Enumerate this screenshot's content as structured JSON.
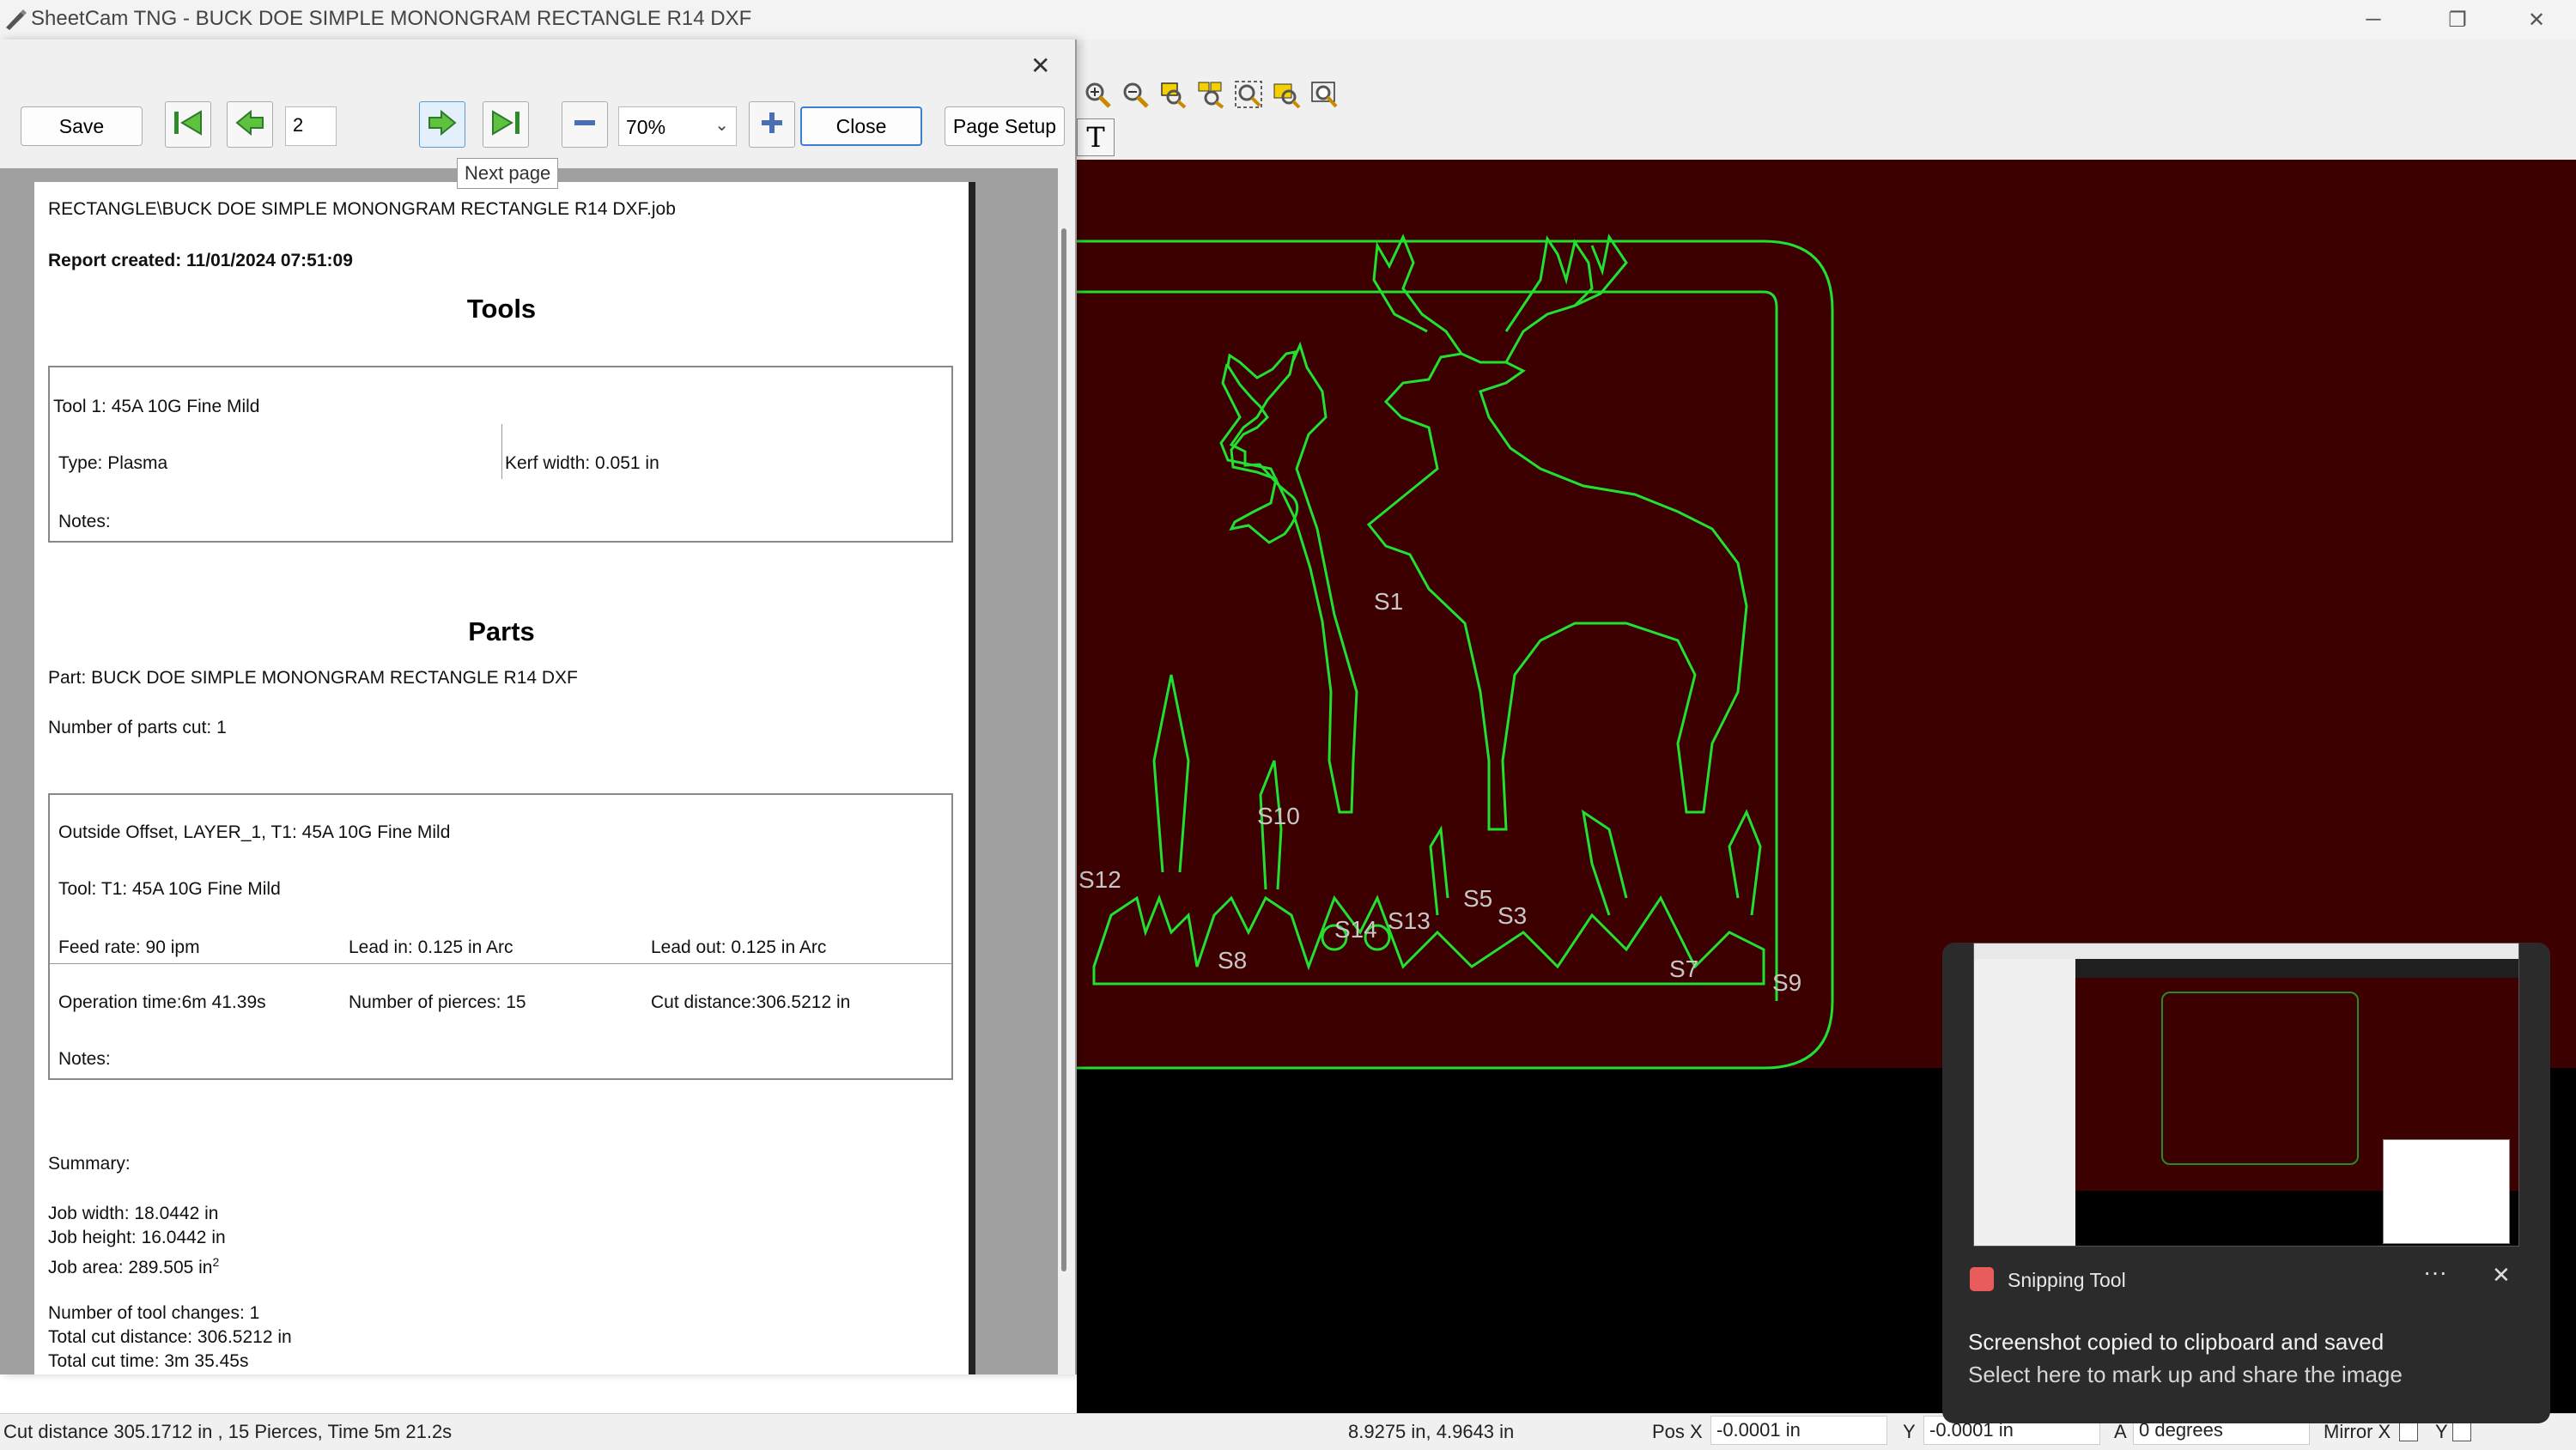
{
  "window": {
    "title": "SheetCam TNG - BUCK DOE SIMPLE MONONGRAM RECTANGLE R14 DXF",
    "minimize": "─",
    "restore": "❐",
    "close": "✕"
  },
  "preview": {
    "close": "✕",
    "save_label": "Save",
    "page_number": "2",
    "zoom": "70%",
    "close_label": "Close",
    "page_setup_label": "Page Setup",
    "tooltip": "Next page"
  },
  "report": {
    "job_path": "RECTANGLE\\BUCK DOE SIMPLE MONONGRAM RECTANGLE R14 DXF.job",
    "created": "Report created: 11/01/2024 07:51:09",
    "tools_heading": "Tools",
    "tool": {
      "name": "Tool 1: 45A 10G Fine Mild",
      "type": "Type: Plasma",
      "kerf": "Kerf width: 0.051 in",
      "notes": "Notes:"
    },
    "parts_heading": "Parts",
    "part_name": "Part: BUCK DOE SIMPLE MONONGRAM RECTANGLE R14 DXF",
    "parts_cut": "Number of parts cut: 1",
    "operation": {
      "title": "Outside Offset, LAYER_1, T1: 45A 10G Fine Mild",
      "tool": "Tool: T1: 45A 10G Fine Mild",
      "feed": "Feed rate: 90 ipm",
      "lead_in": "Lead in: 0.125 in Arc",
      "lead_out": "Lead out: 0.125 in Arc",
      "op_time": "Operation time:6m 41.39s",
      "pierces": "Number of pierces: 15",
      "cut_distance": "Cut distance:306.5212 in",
      "notes": "Notes:"
    },
    "summary": {
      "heading": "Summary:",
      "job_width": "Job width: 18.0442 in",
      "job_height": "Job height: 16.0442 in",
      "job_area": "Job area: 289.505 in",
      "job_area_sup": "2",
      "tool_changes": "Number of tool changes: 1",
      "total_cut_distance": "Total cut distance: 306.5212 in",
      "total_cut_time": "Total cut time: 3m 35.45s"
    }
  },
  "canvas": {
    "labels": [
      "S1",
      "S10",
      "S12",
      "S14",
      "S13",
      "S5",
      "S3",
      "S8",
      "S7",
      "S9"
    ],
    "background_color": "#3d0000",
    "path_color": "#22e030"
  },
  "statusbar": {
    "cut_info": "Cut distance 305.1712 in , 15 Pierces, Time 5m 21.2s",
    "cursor": "8.9275 in, 4.9643 in",
    "pos_x_label": "Pos X",
    "pos_x": "-0.0001 in",
    "y_label": "Y",
    "pos_y": "-0.0001 in",
    "a_label": "A",
    "angle": "0 degrees",
    "mirror_x": "Mirror X",
    "mirror_y": "Y"
  },
  "toast": {
    "app": "Snipping Tool",
    "more": "···",
    "close": "✕",
    "message": "Screenshot copied to clipboard and saved",
    "sub": "Select here to mark up and share the image"
  }
}
